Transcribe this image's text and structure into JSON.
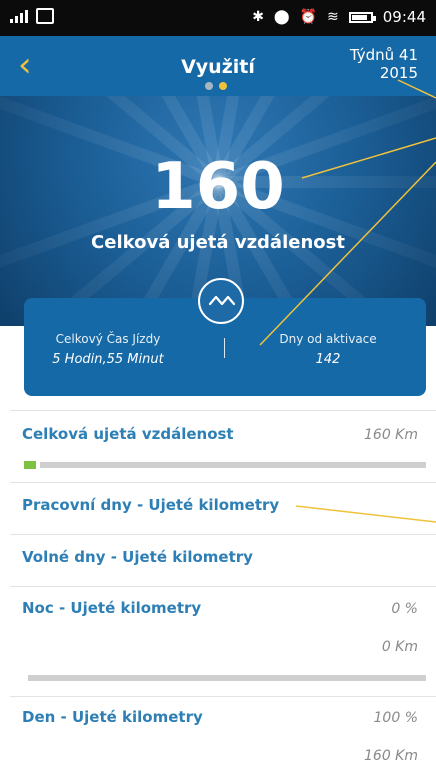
{
  "statusbar": {
    "time": "09:44"
  },
  "header": {
    "title": "Využití",
    "week_line1": "Týdnů 41",
    "week_line2": "2015",
    "pager": {
      "count": 2,
      "active_index": 1
    }
  },
  "summary": {
    "total_value": "160",
    "total_label": "Celková ujetá vzdálenost",
    "drive_time_label": "Celkový Čas Jízdy",
    "drive_time_value": "5 Hodin,55 Minut",
    "days_label": "Dny od aktivace",
    "days_value": "142"
  },
  "stats": [
    {
      "title": "Celková ujetá vzdálenost",
      "value": "160 Km",
      "progress_fraction": 0.03
    },
    {
      "title": "Pracovní dny - Ujeté kilometry"
    },
    {
      "title": "Volné dny - Ujeté kilometry"
    },
    {
      "title": "Noc - Ujeté kilometry",
      "percent": "0 %",
      "km": "0 Km"
    },
    {
      "title": "Den - Ujeté kilometry",
      "percent": "100 %",
      "km": "160 Km"
    }
  ],
  "colors": {
    "accent_yellow": "#f0c23b",
    "header_blue": "#1569a6",
    "title_blue": "#2d7fb5",
    "progress_green": "#7dc242"
  }
}
